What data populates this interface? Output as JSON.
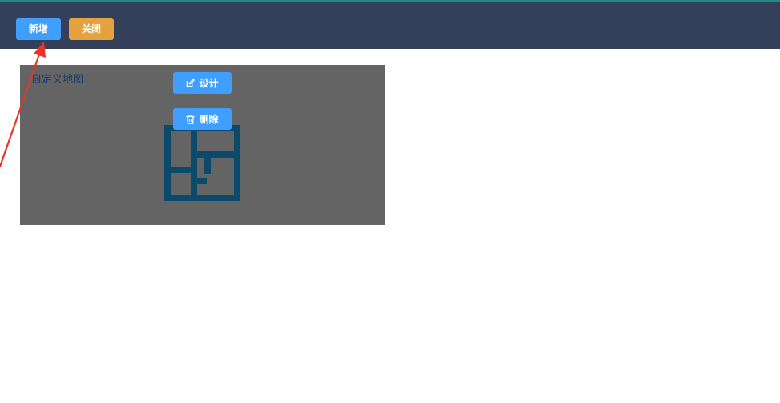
{
  "toolbar": {
    "add_label": "新增",
    "close_label": "关闭"
  },
  "map_card": {
    "title": "自定义地图",
    "design_label": "设计",
    "delete_label": "删除",
    "design_icon": "edit-icon",
    "delete_icon": "trash-icon",
    "thumbnail_icon": "floorplan-icon"
  },
  "colors": {
    "header_bg": "#34405a",
    "primary": "#409eff",
    "warning": "#e6a23c",
    "card_bg": "#646464",
    "annotation_arrow": "#e8332a"
  }
}
